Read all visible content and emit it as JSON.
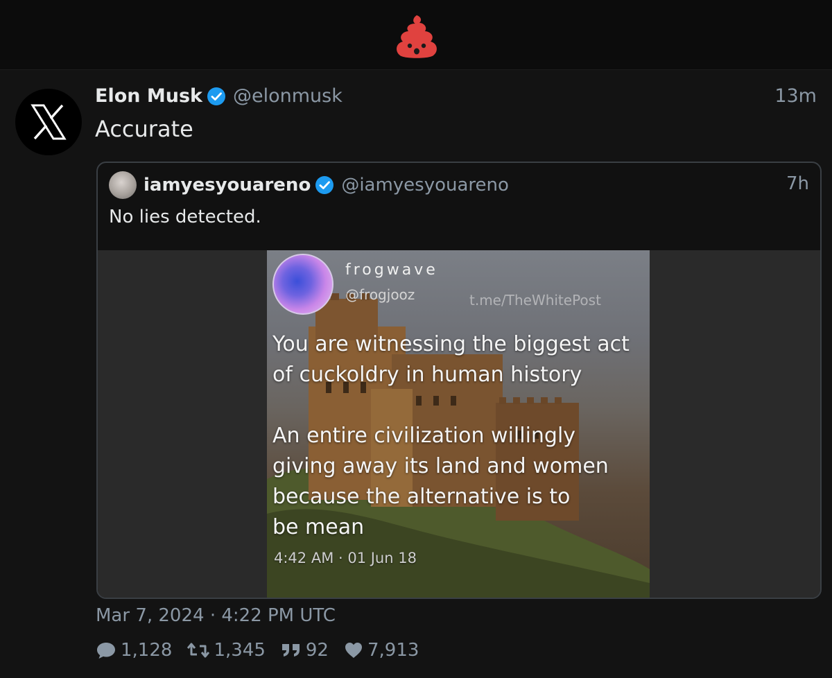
{
  "brand": {
    "logo_icon": "poop-emoji-icon",
    "logo_color": "#e0423f"
  },
  "tweet": {
    "avatar_icon": "x-logo-icon",
    "display_name": "Elon Musk",
    "handle": "@elonmusk",
    "time": "13m",
    "text": "Accurate",
    "timestamp": "Mar 7, 2024 · 4:22 PM UTC",
    "stats": {
      "replies": "1,128",
      "retweets": "1,345",
      "quotes": "92",
      "likes": "7,913"
    }
  },
  "quote": {
    "display_name": "iamyesyouareno",
    "handle": "@iamyesyouareno",
    "time": "7h",
    "text": "No lies detected."
  },
  "media": {
    "name": "frogwave",
    "handle": "@frogjooz",
    "watermark": "t.me/TheWhitePost",
    "lines": [
      "You are witnessing the biggest act",
      "of cuckoldry in human history",
      "An entire civilization willingly",
      "giving away its land and women",
      "because the alternative is to",
      "be mean"
    ],
    "stamp": "4:42 AM · 01 Jun 18"
  },
  "colors": {
    "verified": "#1d9bf0",
    "muted": "#8b98a5",
    "text": "#e7e9ea"
  }
}
